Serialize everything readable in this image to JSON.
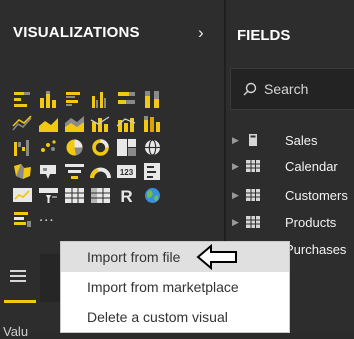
{
  "visualizations": {
    "title": "VISUALIZATIONS",
    "expand_glyph": "›",
    "more_glyph": "..."
  },
  "fields": {
    "title": "FIELDS",
    "search": {
      "placeholder": "Search"
    },
    "tables": [
      {
        "label": "Sales",
        "icon": "calculator-icon"
      },
      {
        "label": "Calendar",
        "icon": "table-icon"
      },
      {
        "label": "Customers",
        "icon": "table-icon"
      },
      {
        "label": "Products",
        "icon": "table-icon"
      },
      {
        "label": "Purchases",
        "icon": "table-icon"
      }
    ]
  },
  "context_menu": {
    "items": [
      {
        "label": "Import from file",
        "highlighted": true
      },
      {
        "label": "Import from marketplace",
        "highlighted": false
      },
      {
        "label": "Delete a custom visual",
        "highlighted": false
      }
    ]
  },
  "bottom": {
    "values_label": "Valu"
  },
  "colors": {
    "accent": "#f2c811",
    "panel_bg": "#2d2d2d",
    "menu_highlight": "#e0e0e0"
  }
}
